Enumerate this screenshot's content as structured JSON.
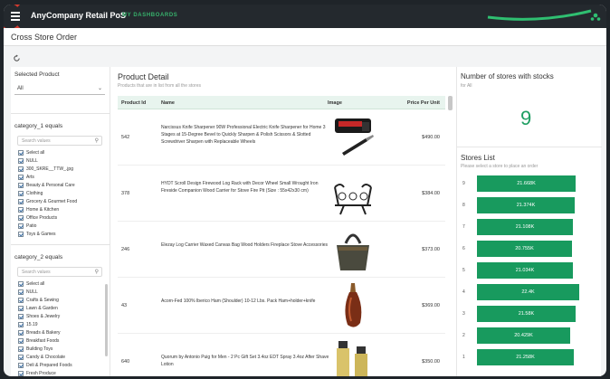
{
  "app": {
    "title": "AnyCompany Retail PoS",
    "dashboards_link": "MY DASHBOARDS"
  },
  "page": {
    "title": "Cross Store Order"
  },
  "selected_product": {
    "label": "Selected Product",
    "value": "All"
  },
  "category_1": {
    "label": "category_1 equals",
    "search_placeholder": "Search values",
    "options": [
      "Select all",
      "NULL",
      "300_SKRE__TTW_.jpg",
      "Arts",
      "Beauty & Personal Care",
      "Clothing",
      "Grocery & Gourmet Food",
      "Home & Kitchen",
      "Office Products",
      "Patio",
      "Toys & Games"
    ]
  },
  "category_2": {
    "label": "category_2 equals",
    "search_placeholder": "Search values",
    "options": [
      "Select all",
      "NULL",
      "Crafts & Sewing",
      "Lawn & Garden",
      "Shoes & Jewelry",
      "15.19",
      "Breads & Bakery",
      "Breakfast Foods",
      "Building Toys",
      "Candy & Chocolate",
      "Deli & Prepared Foods",
      "Fresh Produce"
    ]
  },
  "product_detail": {
    "title": "Product Detail",
    "subtitle": "Products that are in list from all the stores",
    "columns": [
      "Product Id",
      "Name",
      "Image",
      "Price Per Unit"
    ],
    "rows": [
      {
        "id": "542",
        "name": "Narcissus Knife Sharpener 90W Professional Electric Knife Sharpener for Home 3 Stages at 15-Degree Bevel to Quickly Sharpen & Polish Scissors & Slotted Screwdriver Sharpen with Replaceable Wheels",
        "price": "$490.00",
        "image": "knife-sharpener-image"
      },
      {
        "id": "378",
        "name": "HYDT Scroll Design Firewood Log Rack with Decor Wheel Small Wrought Iron Fireside Companion Wood Carrier for Stove Fire Pit (Size : 55x42x30 cm)",
        "price": "$384.00",
        "image": "log-rack-image"
      },
      {
        "id": "246",
        "name": "Elezay Log Carrier Waxed Canvas Bag Wood Holders Fireplace Stove Accessories",
        "price": "$373.00",
        "image": "log-carrier-bag-image"
      },
      {
        "id": "43",
        "name": "Acorn-Fed 100% Iberico Ham (Shoulder) 10-12 Lbs. Pack Ham+holder+knife",
        "price": "$369.00",
        "image": "iberico-ham-image"
      },
      {
        "id": "640",
        "name": "Quorum by Antonio Puig for Men - 2 Pc Gift Set 3.4oz EDT Spray 3.4oz After Shave Lotion",
        "price": "$350.00",
        "image": "cologne-gift-set-image"
      }
    ]
  },
  "stores_count": {
    "title": "Number of stores with stocks",
    "subtitle": "for All",
    "value": "9"
  },
  "stores_list": {
    "title": "Stores List",
    "subtitle": "Please select a store to place an order",
    "max_value": 22.4,
    "rows": [
      {
        "id": "9",
        "label": "21.668K",
        "value": 21.668
      },
      {
        "id": "8",
        "label": "21.374K",
        "value": 21.374
      },
      {
        "id": "7",
        "label": "21.108K",
        "value": 21.108
      },
      {
        "id": "6",
        "label": "20.755K",
        "value": 20.755
      },
      {
        "id": "5",
        "label": "21.034K",
        "value": 21.034
      },
      {
        "id": "4",
        "label": "22.4K",
        "value": 22.4
      },
      {
        "id": "3",
        "label": "21.58K",
        "value": 21.58
      },
      {
        "id": "2",
        "label": "20.429K",
        "value": 20.429
      },
      {
        "id": "1",
        "label": "21.258K",
        "value": 21.258
      }
    ]
  },
  "colors": {
    "accent_green": "#189a5e",
    "topbar": "#24292e",
    "logo_red": "#d63b2f"
  }
}
